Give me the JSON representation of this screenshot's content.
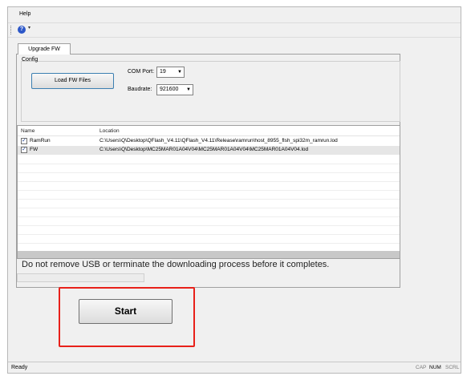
{
  "menubar": {
    "help_label": "Help"
  },
  "toolbar": {
    "help_icon_glyph": "?",
    "overflow_glyph": "▾"
  },
  "tabs": [
    {
      "label": "Upgrade FW",
      "active": true
    }
  ],
  "config": {
    "group_label": "Config",
    "load_button_label": "Load FW Files",
    "com_port": {
      "label": "COM Port:",
      "value": "19"
    },
    "baudrate": {
      "label": "Baudrate:",
      "value": "921600"
    }
  },
  "file_table": {
    "columns": [
      "Name",
      "Location"
    ],
    "rows": [
      {
        "checked": true,
        "check_glyph": "✓",
        "name": "RamRun",
        "location": "C:\\Users\\Q\\Desktop\\QFlash_V4.11\\QFlash_V4.11\\Release\\ramrun\\host_8955_flsh_spi32m_ramrun.lod"
      },
      {
        "checked": true,
        "check_glyph": "✓",
        "name": "FW",
        "location": "C:\\Users\\Q\\Desktop\\MC25MAR01A04V04\\MC25MAR01A04V04\\MC25MAR01A04V04.lod"
      }
    ]
  },
  "warning_text": "Do not remove USB or terminate the downloading process before it completes.",
  "progress": {
    "value": 0
  },
  "start_button_label": "Start",
  "colors": {
    "highlight": "#e8211a",
    "accent": "#3c7fb1"
  },
  "statusbar": {
    "status": "Ready",
    "indicators": [
      {
        "label": "CAP",
        "active": false
      },
      {
        "label": "NUM",
        "active": true
      },
      {
        "label": "SCRL",
        "active": false
      }
    ]
  }
}
